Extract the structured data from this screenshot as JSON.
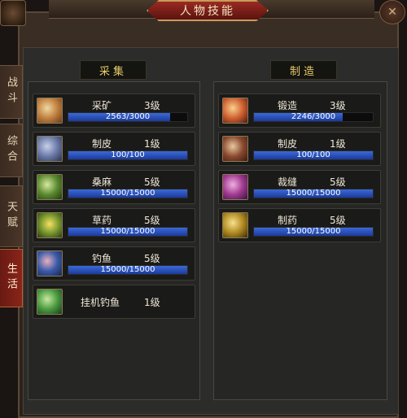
{
  "window": {
    "title": "人物技能"
  },
  "tabs": [
    {
      "label": "战斗",
      "active": false
    },
    {
      "label": "综合",
      "active": false
    },
    {
      "label": "天赋",
      "active": false
    },
    {
      "label": "生活",
      "active": true
    }
  ],
  "gather": {
    "header": "采集",
    "skills": [
      {
        "name": "采矿",
        "level": "3级",
        "progress": "2563/3000",
        "fraction": 0.854,
        "icon": "pickaxe-icon"
      },
      {
        "name": "制皮",
        "level": "1级",
        "progress": "100/100",
        "fraction": 1.0,
        "icon": "skinning-knife-icon"
      },
      {
        "name": "桑麻",
        "level": "5级",
        "progress": "15000/15000",
        "fraction": 1.0,
        "icon": "mulberry-leaf-icon"
      },
      {
        "name": "草药",
        "level": "5级",
        "progress": "15000/15000",
        "fraction": 1.0,
        "icon": "herb-flower-icon"
      },
      {
        "name": "钓鱼",
        "level": "5级",
        "progress": "15000/15000",
        "fraction": 1.0,
        "icon": "fishing-rod-icon"
      },
      {
        "name": "挂机钓鱼",
        "level": "1级",
        "icon": "idle-fishing-icon"
      }
    ]
  },
  "craft": {
    "header": "制造",
    "skills": [
      {
        "name": "锻造",
        "level": "3级",
        "progress": "2246/3000",
        "fraction": 0.749,
        "icon": "anvil-hammer-icon"
      },
      {
        "name": "制皮",
        "level": "1级",
        "progress": "100/100",
        "fraction": 1.0,
        "icon": "leatherworking-icon"
      },
      {
        "name": "裁缝",
        "level": "5级",
        "progress": "15000/15000",
        "fraction": 1.0,
        "icon": "tailoring-icon"
      },
      {
        "name": "制药",
        "level": "5级",
        "progress": "15000/15000",
        "fraction": 1.0,
        "icon": "alchemy-cauldron-icon"
      }
    ]
  },
  "colors": {
    "bar_fill": "#2a4fc0",
    "header_text": "#e8cc6a",
    "active_tab": "#7a1f16"
  }
}
